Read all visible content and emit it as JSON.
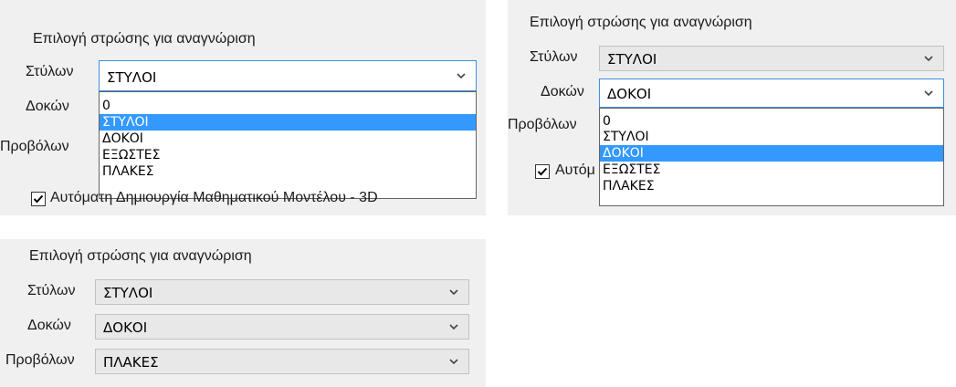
{
  "panels": [
    {
      "title": "Επιλογή στρώσης για αναγνώριση",
      "labels": [
        "Στύλων",
        "Δοκών",
        "Προβόλων"
      ],
      "combo_value": "ΣΤΥΛΟΙ",
      "options": [
        "0",
        "ΣΤΥΛΟΙ",
        "ΔΟΚΟΙ",
        "ΕΞΩΣΤΕΣ",
        "ΠΛΑΚΕΣ"
      ],
      "selected_option": "ΣΤΥΛΟΙ",
      "checkbox_label": "Αυτόματη Δημιουργία Μαθηματικού Μοντέλου - 3D",
      "checkbox_checked": true
    },
    {
      "title": "Επιλογή στρώσης για αναγνώριση",
      "labels": [
        "Στύλων",
        "Δοκών",
        "Προβόλων"
      ],
      "combo_values": [
        "ΣΤΥΛΟΙ",
        "ΔΟΚΟΙ"
      ],
      "options": [
        "0",
        "ΣΤΥΛΟΙ",
        "ΔΟΚΟΙ",
        "ΕΞΩΣΤΕΣ",
        "ΠΛΑΚΕΣ"
      ],
      "selected_option": "ΔΟΚΟΙ",
      "checkbox_label": "Αυτόμ",
      "checkbox_checked": true
    },
    {
      "title": "Επιλογή στρώσης για αναγνώριση",
      "labels": [
        "Στύλων",
        "Δοκών",
        "Προβόλων"
      ],
      "combo_values": [
        "ΣΤΥΛΟΙ",
        "ΔΟΚΟΙ",
        "ΠΛΑΚΕΣ"
      ]
    }
  ],
  "icons": {
    "dropdown_arrow": "chevron-down-icon",
    "checkbox": "checkmark-icon"
  },
  "colors": {
    "selection": "#3399ff",
    "panel_bg": "#f0f0f0",
    "focus_border": "#3d8fe0"
  }
}
